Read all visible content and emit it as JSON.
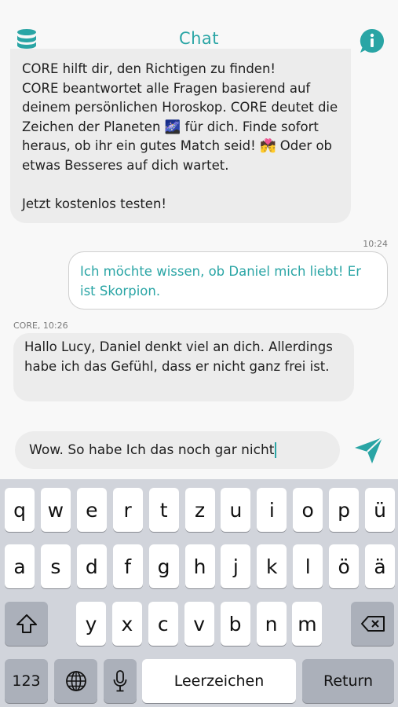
{
  "header": {
    "title": "Chat",
    "left_icon": "database-icon",
    "right_icon": "info-icon"
  },
  "messages": [
    {
      "type": "bot",
      "text": "CORE hilft dir, den Richtigen zu finden!\nCORE beantwortet alle Fragen basierend auf deinem persönlichen Horoskop. CORE deutet die Zeichen der Planeten 🌌 für dich. Finde sofort heraus, ob ihr ein gutes Match seid! 💏 Oder ob etwas Besseres auf dich wartet.\n\nJetzt kostenlos testen!"
    },
    {
      "type": "user",
      "time": "10:24",
      "text": "Ich möchte wissen, ob Daniel mich liebt! Er ist Skorpion."
    },
    {
      "type": "bot",
      "sender_time": "CORE, 10:26",
      "text": "Hallo Lucy, Daniel denkt viel an dich. Allerdings habe ich das Gefühl, dass er nicht ganz frei ist."
    }
  ],
  "composer": {
    "value": "Wow. So habe Ich das noch gar nicht",
    "send_icon": "send-icon"
  },
  "keyboard": {
    "row1": [
      "q",
      "w",
      "e",
      "r",
      "t",
      "z",
      "u",
      "i",
      "o",
      "p",
      "ü"
    ],
    "row2": [
      "a",
      "s",
      "d",
      "f",
      "g",
      "h",
      "j",
      "k",
      "l",
      "ö",
      "ä"
    ],
    "row3": [
      "y",
      "x",
      "c",
      "v",
      "b",
      "n",
      "m"
    ],
    "numbers_label": "123",
    "space_label": "Leerzeichen",
    "return_label": "Return",
    "shift_icon": "shift-icon",
    "delete_icon": "backspace-icon",
    "globe_icon": "globe-icon",
    "mic_icon": "microphone-icon"
  },
  "colors": {
    "accent": "#2aa5a5",
    "bot_bubble": "#ececec",
    "keyboard_bg": "#d1d4db"
  }
}
